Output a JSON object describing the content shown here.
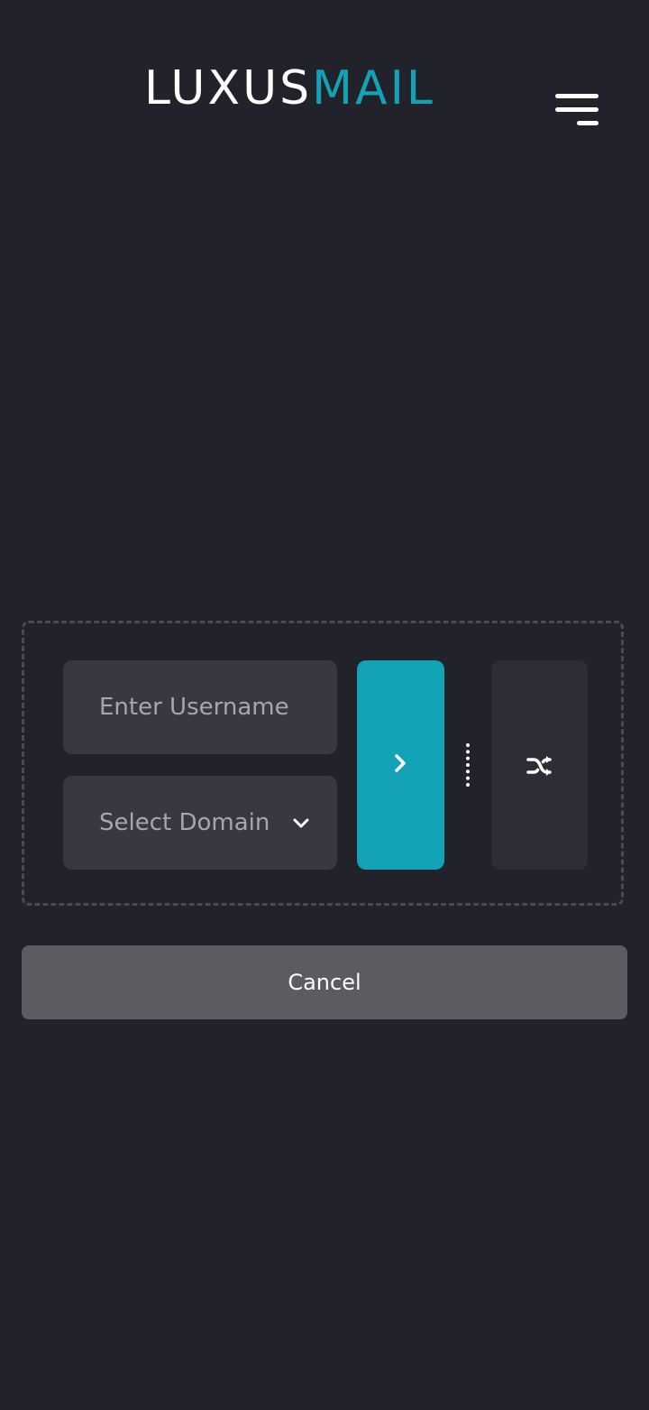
{
  "header": {
    "logo_part1": "LUXUS",
    "logo_part2": "MAIL",
    "menu_icon": "hamburger-menu-icon"
  },
  "form": {
    "username_placeholder": "Enter Username",
    "domain_select": {
      "selected": "Select Domain",
      "icon": "chevron-down-icon"
    },
    "submit_icon": "chevron-right-icon",
    "random_icon": "shuffle-icon"
  },
  "actions": {
    "cancel_label": "Cancel"
  },
  "colors": {
    "background": "#22222b",
    "accent": "#12a3b6",
    "field": "#383840",
    "random_button": "#2d2d36",
    "cancel_button": "#5b5b61",
    "placeholder_text": "#a6a6ad"
  }
}
